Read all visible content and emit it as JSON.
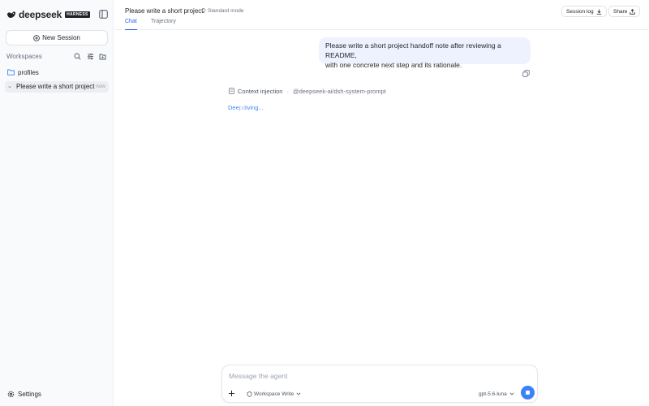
{
  "brand": {
    "name": "deepseek",
    "badge": "HARNESS",
    "color": "#1f2329"
  },
  "sidebar": {
    "new_session_label": "New Session",
    "workspaces_title": "Workspaces",
    "tools": [
      "search-icon",
      "filter-icon",
      "new-folder-icon"
    ],
    "folder": {
      "name": "profiles",
      "icon": "folder-icon"
    },
    "sessions": [
      {
        "title": "Please write a short project",
        "time": "now",
        "caret": "⌄",
        "active": true
      }
    ],
    "settings_label": "Settings"
  },
  "header": {
    "title": "Please write a short project",
    "mode": "Standard mode",
    "tabs": [
      {
        "label": "Chat",
        "active": true
      },
      {
        "label": "Trajectory",
        "active": false
      }
    ],
    "session_log_label": "Session log",
    "share_label": "Share"
  },
  "chat": {
    "user_message_line1": "Please write a short project handoff note after reviewing a README,",
    "user_message_line2": "with one concrete next step and its rationale.",
    "context": {
      "label": "Context injection",
      "separator": "·",
      "mention": "@deepseek-ai/dsh-system-prompt"
    },
    "status": "Deepdiving..."
  },
  "composer": {
    "placeholder": "Message the agent",
    "permission": "Workspace Write",
    "model": "gpt-5.6-luna",
    "accent_color": "#3b82f6"
  }
}
